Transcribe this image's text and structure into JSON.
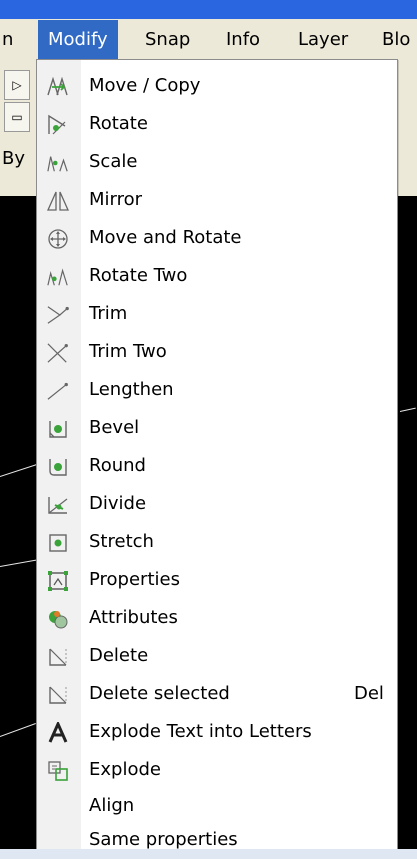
{
  "menubar": {
    "items": [
      {
        "label": "n"
      },
      {
        "label": "Modify"
      },
      {
        "label": "Snap"
      },
      {
        "label": "Info"
      },
      {
        "label": "Layer"
      },
      {
        "label": "Blo"
      }
    ]
  },
  "toolbar": {
    "by_label": "By"
  },
  "modify_menu": {
    "items": [
      {
        "label": "Move / Copy",
        "icon": "move-copy-icon"
      },
      {
        "label": "Rotate",
        "icon": "rotate-icon"
      },
      {
        "label": "Scale",
        "icon": "scale-icon"
      },
      {
        "label": "Mirror",
        "icon": "mirror-icon"
      },
      {
        "label": "Move and Rotate",
        "icon": "move-and-rotate-icon"
      },
      {
        "label": "Rotate Two",
        "icon": "rotate-two-icon"
      },
      {
        "label": "Trim",
        "icon": "trim-icon"
      },
      {
        "label": "Trim Two",
        "icon": "trim-two-icon"
      },
      {
        "label": "Lengthen",
        "icon": "lengthen-icon"
      },
      {
        "label": "Bevel",
        "icon": "bevel-icon"
      },
      {
        "label": "Round",
        "icon": "round-icon"
      },
      {
        "label": "Divide",
        "icon": "divide-icon"
      },
      {
        "label": "Stretch",
        "icon": "stretch-icon"
      },
      {
        "label": "Properties",
        "icon": "properties-icon"
      },
      {
        "label": "Attributes",
        "icon": "attributes-icon"
      },
      {
        "label": "Delete",
        "icon": "delete-icon"
      },
      {
        "label": "Delete selected",
        "icon": "delete-selected-icon",
        "shortcut": "Del"
      },
      {
        "label": "Explode Text into Letters",
        "icon": "explode-text-icon"
      },
      {
        "label": "Explode",
        "icon": "explode-icon"
      },
      {
        "label": "Align",
        "icon": ""
      },
      {
        "label": "Same properties",
        "icon": ""
      }
    ]
  },
  "colors": {
    "menu_highlight": "#316ac5",
    "menubar_bg": "#ece9d8",
    "title_blue": "#2a66e0",
    "icon_green": "#3aa33a",
    "canvas": "#000000"
  }
}
